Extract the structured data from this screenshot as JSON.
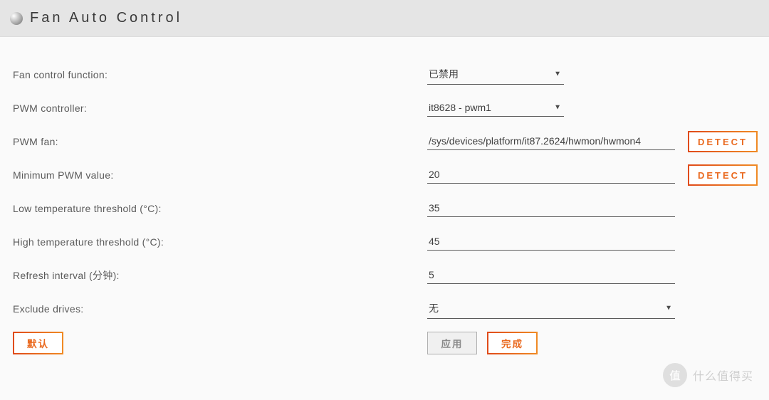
{
  "header": {
    "title": "Fan Auto Control"
  },
  "form": {
    "fan_control_function": {
      "label": "Fan control function:",
      "value": "已禁用"
    },
    "pwm_controller": {
      "label": "PWM controller:",
      "value": "it8628 - pwm1"
    },
    "pwm_fan": {
      "label": "PWM fan:",
      "value": "/sys/devices/platform/it87.2624/hwmon/hwmon4",
      "detect_label": "DETECT"
    },
    "min_pwm": {
      "label": "Minimum PWM value:",
      "value": "20",
      "detect_label": "DETECT"
    },
    "low_temp": {
      "label": "Low temperature threshold (°C):",
      "value": "35"
    },
    "high_temp": {
      "label": "High temperature threshold (°C):",
      "value": "45"
    },
    "refresh_interval": {
      "label": "Refresh interval (分钟):",
      "value": "5"
    },
    "exclude_drives": {
      "label": "Exclude drives:",
      "value": "无"
    }
  },
  "buttons": {
    "default": "默认",
    "apply": "应用",
    "done": "完成"
  },
  "watermark": {
    "badge": "值",
    "text": "什么值得买"
  }
}
